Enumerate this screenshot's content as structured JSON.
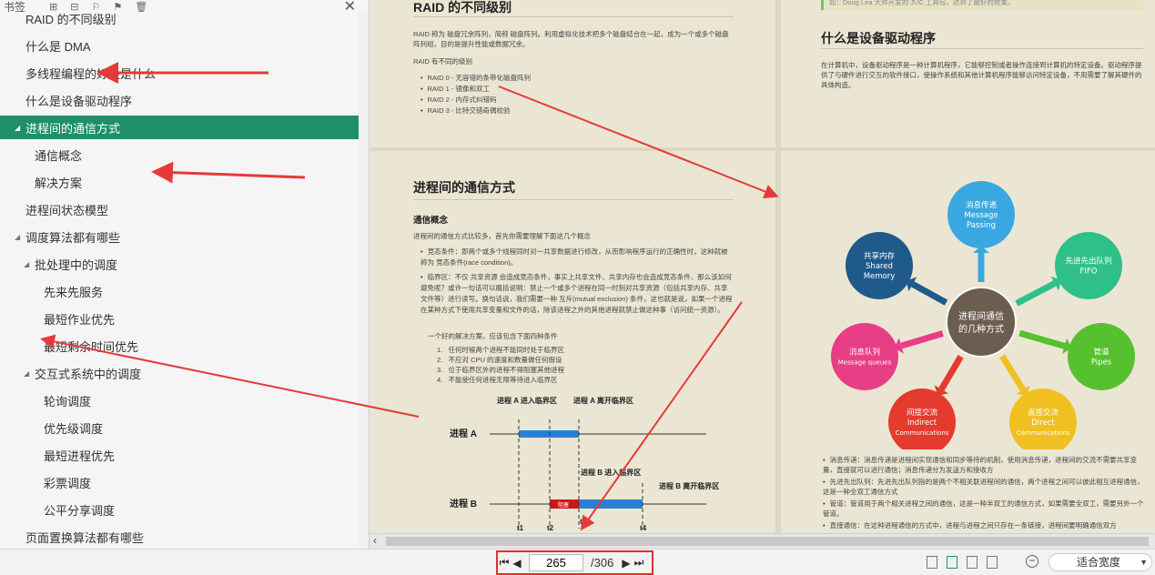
{
  "sidebar": {
    "header": {
      "title": "书签"
    },
    "items": [
      {
        "label": "RAID 的不同级别",
        "level": 1
      },
      {
        "label": "什么是 DMA",
        "level": 1
      },
      {
        "label": "多线程编程的好处是什么",
        "level": 1
      },
      {
        "label": "什么是设备驱动程序",
        "level": 1
      },
      {
        "label": "进程间的通信方式",
        "level": 1,
        "expanded": true,
        "active": true
      },
      {
        "label": "通信概念",
        "level": 2
      },
      {
        "label": "解决方案",
        "level": 2
      },
      {
        "label": "进程间状态模型",
        "level": 1
      },
      {
        "label": "调度算法都有哪些",
        "level": 1,
        "expanded": true
      },
      {
        "label": "批处理中的调度",
        "level": 2,
        "expanded": true
      },
      {
        "label": "先来先服务",
        "level": 3
      },
      {
        "label": "最短作业优先",
        "level": 3
      },
      {
        "label": "最短剩余时间优先",
        "level": 3
      },
      {
        "label": "交互式系统中的调度",
        "level": 2,
        "expanded": true
      },
      {
        "label": "轮询调度",
        "level": 3
      },
      {
        "label": "优先级调度",
        "level": 3
      },
      {
        "label": "最短进程优先",
        "level": 3
      },
      {
        "label": "彩票调度",
        "level": 3
      },
      {
        "label": "公平分享调度",
        "level": 3
      },
      {
        "label": "页面置换算法都有哪些",
        "level": 1
      }
    ]
  },
  "pages": {
    "raid": {
      "title": "RAID 的不同级别",
      "intro": "RAID 称为 磁盘冗余阵列，简称 磁盘阵列。利用虚拟化技术把多个磁盘结合在一起，成为一个或多个磁盘阵列组，目的是提升性能或数据冗余。",
      "levels_caption": "RAID 有不同的级别",
      "levels": [
        "RAID 0 - 无容错的条带化磁盘阵列",
        "RAID 1 - 镜像和双工",
        "RAID 2 - 内存式纠错码",
        "RAID 3 - 比特交错奇偶校验"
      ]
    },
    "driver": {
      "quote": "如：Doug Lea 大师开发的 JUC 工具包，达到了最好的效果。",
      "title": "什么是设备驱动程序",
      "text": "在计算机中，设备驱动程序是一种计算机程序，它能够控制或者操作连接到计算机的特定设备。驱动程序提供了与硬件进行交互的软件接口，使操作系统和其他计算机程序能够访问特定设备，不用需要了解其硬件的具体构造。"
    },
    "ipc": {
      "title": "进程间的通信方式",
      "subtitle": "通信概念",
      "intro": "进程间的通信方式比较多，首先你需要理解下面这几个概念",
      "bullet1": "竞态条件：即两个或多个线程同时对一共享数据进行修改，从而影响程序运行的正确性时，这种就被称为 竞态条件(race condition)。",
      "bullet2": "临界区：不仅 共享资源 会造成竞态条件，事实上共享文件、共享内存也会造成竞态条件、那么该如何避免呢？或许一句话可以概括说明：禁止一个或多个进程在同一时刻对共享资源（包括共享内存、共享文件等）进行读写。换句话说，我们需要一种 互斥(mutual exclusion) 条件，这也就是说，如果一个进程在某种方式下使用共享变量和文件的话，除该进程之外的其他进程就禁止做这种事（访问统一资源）。",
      "solution_intro": "一个好的解决方案，应该包含下面四种条件",
      "conditions": [
        "任何时候两个进程不能同时处于临界区",
        "不应对 CPU 的速度和数量做任何假设",
        "位于临界区外的进程不得阻塞其他进程",
        "不能使任何进程无限等待进入临界区"
      ],
      "timeline": {
        "processA": "进程 A",
        "processB": "进程 B",
        "a_enter": "进程 A  进入临界区",
        "a_leave": "进程 A  离开临界区",
        "b_try": "进程 B  进入临界区",
        "b_leave": "进程 B  离开临界区",
        "blocked": "阻塞",
        "ticks": [
          "t1",
          "t2",
          "t3",
          "t4"
        ]
      }
    },
    "diagram": {
      "center": "进程间通信\n的几种方式",
      "nodes": [
        {
          "label": "消息传递\nMessage\nPassing",
          "color": "#3aa8e0"
        },
        {
          "label": "先进先出队列\nFIFO",
          "color": "#2fc08a"
        },
        {
          "label": "管道\nPipes",
          "color": "#57c02e"
        },
        {
          "label": "直接交流\nDirect\nCommunications",
          "color": "#f0c020"
        },
        {
          "label": "间接交流\nIndirect\nCommunications",
          "color": "#e53a2e"
        },
        {
          "label": "消息队列\nMessage queues",
          "color": "#e83e86"
        },
        {
          "label": "共享内存\nShared\nMemory",
          "color": "#1f5a8c"
        }
      ],
      "bullets": [
        "消息传递：消息传递是进程间实现通信和同步等待的机制，使用消息传递，进程间的交流不需要共享变量，直接就可以进行通信；消息传递分为发送方和接收方",
        "先进先出队列：先进先出队列指的是两个不相关联进程间的通信，两个进程之间可以彼此相互进程通信，这是一种全双工通信方式",
        "管道：管道用于两个相关进程之间的通信，这是一种半双工的通信方式，如果需要全双工，需要另外一个管道。",
        "直接通信：在这种进程通信的方式中，进程与进程之间只存在一条链接，进程间要明确通信双方"
      ]
    }
  },
  "navigation": {
    "current_page": "265",
    "total_pages": "/306"
  },
  "zoom": {
    "label": "适合宽度"
  }
}
